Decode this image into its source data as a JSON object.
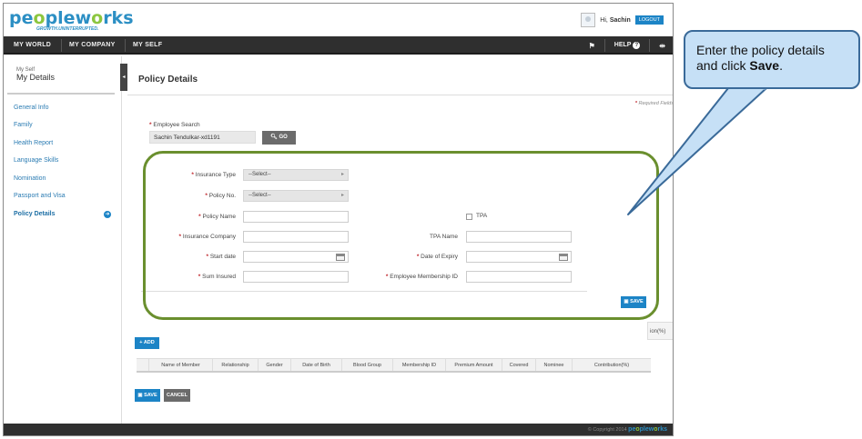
{
  "header": {
    "logo_pre": "pe",
    "logo_o": "o",
    "logo_mid": "ple",
    "logo_w": "w",
    "logo_o2": "o",
    "logo_post": "rks",
    "tagline": "GROWTH.UNINTERRUPTED.",
    "greeting": "Hi,",
    "user_name": "Sachin",
    "logout_label": "LOGOUT"
  },
  "nav": {
    "items": [
      "MY WORLD",
      "MY COMPANY",
      "MY SELF"
    ],
    "help_label": "HELP"
  },
  "sidebar": {
    "small_label": "My Self",
    "title": "My Details",
    "items": [
      "General Info",
      "Family",
      "Health Report",
      "Language Skills",
      "Nomination",
      "Passport and Visa",
      "Policy Details"
    ],
    "active_index": 6
  },
  "page": {
    "title": "Policy Details",
    "required_note": "Required Fields",
    "employee_search_label": "Employee Search",
    "employee_search_value": "Sachin Tendulkar-xd1191",
    "go_label": "GO"
  },
  "form": {
    "insurance_type_label": "Insurance Type",
    "insurance_type_value": "--Select--",
    "policy_no_label": "Policy No.",
    "policy_no_value": "--Select--",
    "policy_name_label": "Policy Name",
    "tpa_label": "TPA",
    "insurance_company_label": "Insurance Company",
    "tpa_name_label": "TPA Name",
    "start_date_label": "Start date",
    "date_of_expiry_label": "Date of Expiry",
    "sum_insured_label": "Sum Insured",
    "membership_id_label": "Employee Membership ID",
    "save_label": "SAVE"
  },
  "table": {
    "add_label": "ADD",
    "partial_header": "ion(%)",
    "columns": [
      "",
      "Name of Member",
      "Relationship",
      "Gender",
      "Date of Birth",
      "Blood Group",
      "Membership ID",
      "Premium Amount",
      "Covered",
      "Nominee",
      "Contribution(%)"
    ]
  },
  "actions": {
    "save_label": "SAVE",
    "cancel_label": "CANCEL"
  },
  "footer": {
    "copyright": "© Copyright 2014",
    "brand_pre": "pe",
    "brand_o": "o",
    "brand_mid": "ple",
    "brand_w": "w",
    "brand_o2": "o",
    "brand_post": "rks"
  },
  "callout": {
    "text_before": "Enter the policy details and click ",
    "text_bold": "Save",
    "text_after": "."
  },
  "colors": {
    "accent": "#1c84c6",
    "highlight": "#6a8f2e",
    "callout_bg": "#c6e0f6",
    "nav_bg": "#2f2f2f"
  }
}
